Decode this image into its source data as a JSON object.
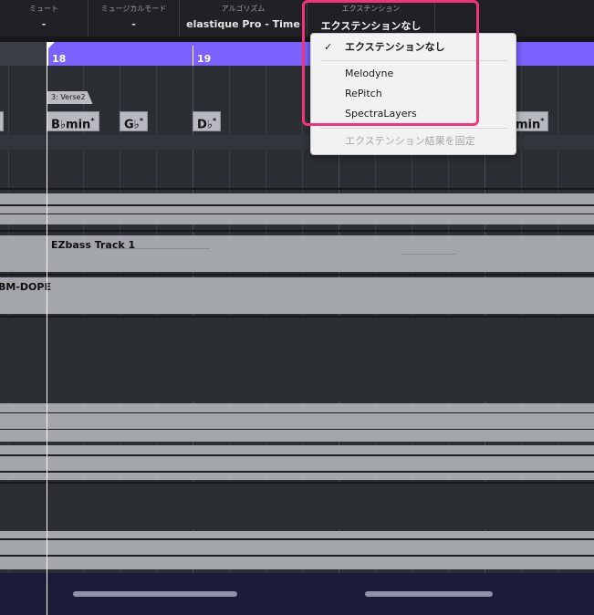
{
  "infoline": {
    "columns": [
      {
        "label": "ミュート",
        "value": "-"
      },
      {
        "label": "ミュージカルモード",
        "value": "-"
      },
      {
        "label": "アルゴリズム",
        "value": "elastique Pro - Time"
      },
      {
        "label": "エクステンション",
        "value": "エクステンションなし"
      }
    ]
  },
  "ruler": {
    "bars": [
      "18",
      "19"
    ]
  },
  "arranger": {
    "section": "3: Verse2"
  },
  "chords": [
    {
      "root": "B♭min",
      "mark": "*"
    },
    {
      "root": "G♭",
      "mark": "*"
    },
    {
      "root": "D♭",
      "mark": "*"
    },
    {
      "root": "min",
      "mark": "*"
    }
  ],
  "tracks": {
    "ezbass": "EZbass Track 1",
    "cut_label": "BM-DOPE"
  },
  "extension_menu": {
    "items": [
      {
        "label": "エクステンションなし",
        "checked": true,
        "bold": true
      },
      {
        "label": "Melodyne"
      },
      {
        "label": "RePitch"
      },
      {
        "label": "SpectraLayers"
      },
      {
        "label": "エクステンション結果を固定",
        "disabled": true
      }
    ],
    "check_icon": "checkmark-icon"
  },
  "colors": {
    "ruler": "#7b61ff",
    "highlight": "#f0357a",
    "event": "#a3a6ab",
    "background": "#2b2e33"
  }
}
